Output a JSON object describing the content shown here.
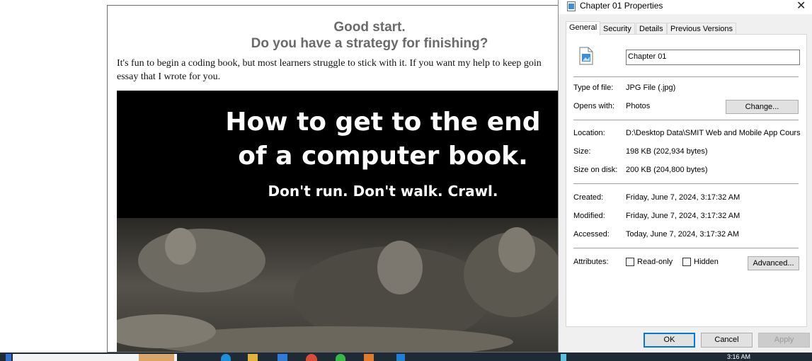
{
  "webpage": {
    "heading_line1": "Good start.",
    "heading_line2": "Do you have a strategy for finishing?",
    "intro_line1": "It's fun to begin a coding book, but most learners struggle to stick with it. If you want my help to keep goin",
    "intro_line2": "essay that I wrote for you.",
    "banner": {
      "headline_line1": "How to get to the end",
      "headline_line2": "of a computer book.",
      "subline": "Don't run. Don't walk. Crawl."
    }
  },
  "dialog": {
    "title": "Chapter 01 Properties",
    "close_glyph": "✕",
    "tabs": [
      {
        "label": "General"
      },
      {
        "label": "Security"
      },
      {
        "label": "Details"
      },
      {
        "label": "Previous Versions"
      }
    ],
    "file_name": "Chapter 01",
    "type_label": "Type of file:",
    "type_value": "JPG File (.jpg)",
    "opens_label": "Opens with:",
    "opens_value": "Photos",
    "change_button": "Change...",
    "location_label": "Location:",
    "location_value": "D:\\Desktop Data\\SMIT Web and Mobile App Cours",
    "size_label": "Size:",
    "size_value": "198 KB (202,934 bytes)",
    "size_disk_label": "Size on disk:",
    "size_disk_value": "200 KB (204,800 bytes)",
    "created_label": "Created:",
    "created_value": "Friday, June 7, 2024, 3:17:32 AM",
    "modified_label": "Modified:",
    "modified_value": "Friday, June 7, 2024, 3:17:32 AM",
    "accessed_label": "Accessed:",
    "accessed_value": "Today, June 7, 2024, 3:17:32 AM",
    "attributes_label": "Attributes:",
    "readonly_label": "Read-only",
    "hidden_label": "Hidden",
    "advanced_button": "Advanced...",
    "ok_button": "OK",
    "cancel_button": "Cancel",
    "apply_button": "Apply"
  },
  "taskbar": {
    "clock": "3:16 AM"
  },
  "colors": {
    "accent": "#0078d7",
    "taskbar": "#1f2a37",
    "dialog_bg": "#f0f0f0"
  }
}
